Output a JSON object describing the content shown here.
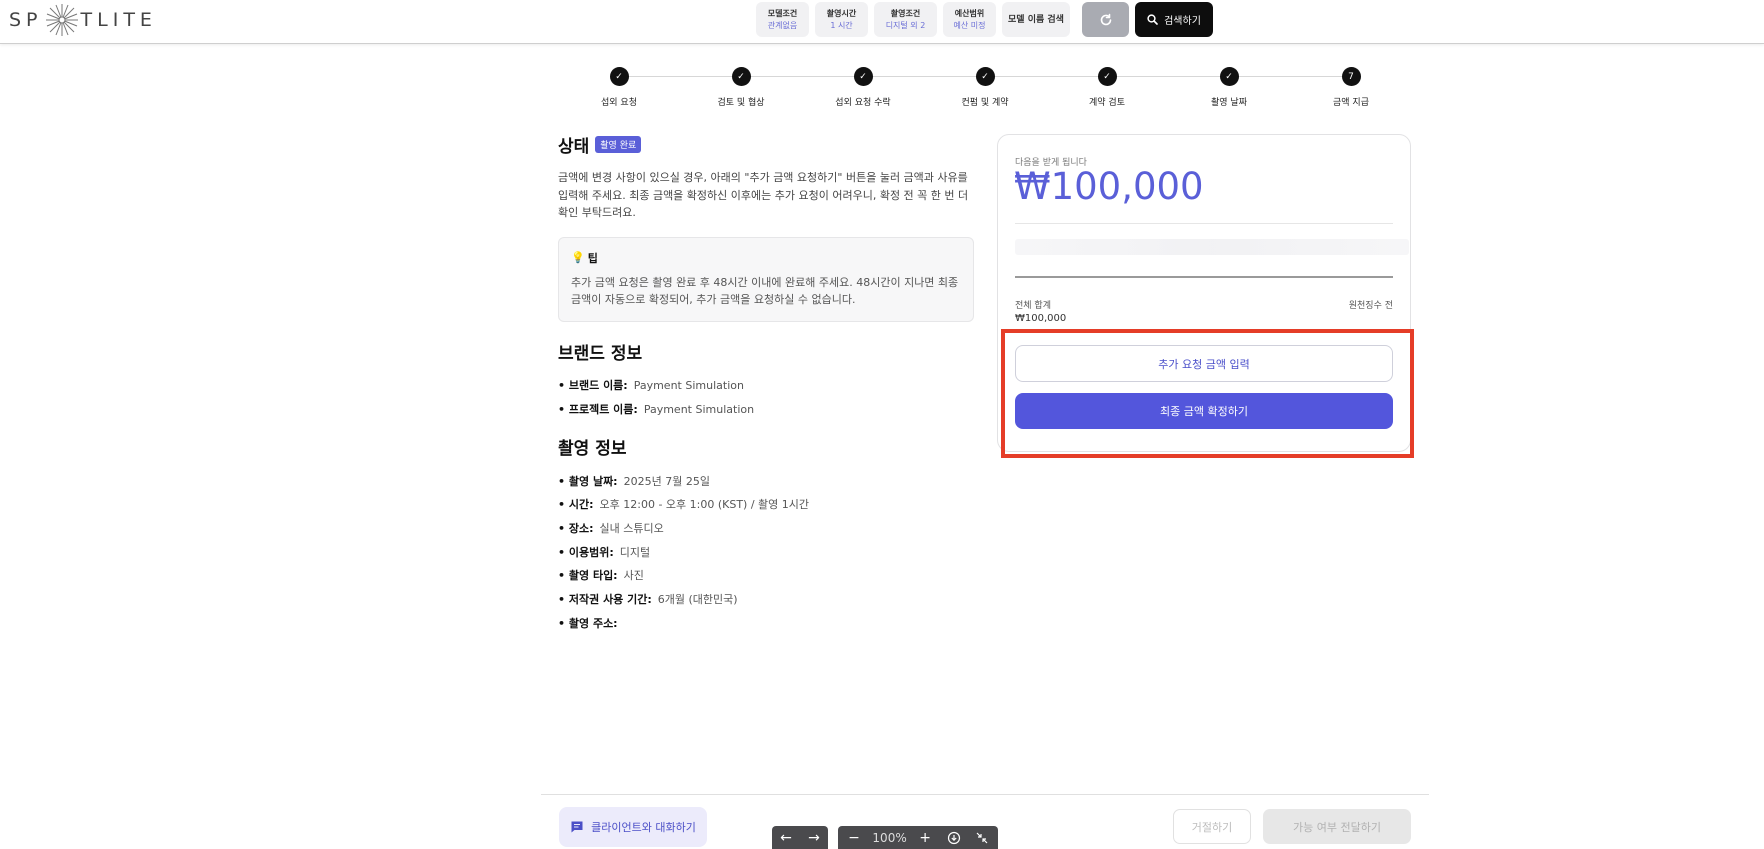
{
  "header": {
    "logo_left": "SP",
    "logo_right": "TLITE",
    "filters": [
      {
        "title": "모델조건",
        "value": "관계없음"
      },
      {
        "title": "촬영시간",
        "value": "1 시간"
      },
      {
        "title": "촬영조건",
        "value": "디지털 외 2"
      },
      {
        "title": "예산범위",
        "value": "예산 미정"
      }
    ],
    "model_name_search": "모델 이름 검색",
    "search_label": "검색하기"
  },
  "steps": [
    {
      "label": "섭외 요청",
      "mark": "✓"
    },
    {
      "label": "검토 및 협상",
      "mark": "✓"
    },
    {
      "label": "섭외 요청 수락",
      "mark": "✓"
    },
    {
      "label": "컨펌 및 계약",
      "mark": "✓"
    },
    {
      "label": "계약 검토",
      "mark": "✓"
    },
    {
      "label": "촬영 날짜",
      "mark": "✓"
    },
    {
      "label": "금액 지급",
      "mark": "7"
    }
  ],
  "status": {
    "title": "상태",
    "badge": "촬영 완료",
    "description": "금액에 변경 사항이 있으실 경우, 아래의 \"추가 금액 요청하기\" 버튼을 눌러 금액과 사유를 입력해 주세요. 최종 금액을 확정하신 이후에는 추가 요청이 어려우니, 확정 전 꼭 한 번 더 확인 부탁드려요.",
    "tip_title": "팁",
    "tip_text": "추가 금액 요청은 촬영 완료 후 48시간 이내에 완료해 주세요. 48시간이 지나면 최종 금액이 자동으로 확정되어, 추가 금액을 요청하실 수 없습니다."
  },
  "brand": {
    "title": "브랜드 정보",
    "items": [
      {
        "label": "브랜드 이름:",
        "value": "Payment Simulation"
      },
      {
        "label": "프로젝트 이름:",
        "value": "Payment Simulation"
      }
    ]
  },
  "shoot": {
    "title": "촬영 정보",
    "items": [
      {
        "label": "촬영 날짜:",
        "value": "2025년 7월 25일"
      },
      {
        "label": "시간:",
        "value": "오후 12:00 - 오후 1:00 (KST) / 촬영 1시간"
      },
      {
        "label": "장소:",
        "value": "실내 스튜디오"
      },
      {
        "label": "이용범위:",
        "value": "디지털"
      },
      {
        "label": "촬영 타입:",
        "value": "사진"
      },
      {
        "label": "저작권 사용 기간:",
        "value": "6개월 (대한민국)"
      },
      {
        "label": "촬영 주소:",
        "value": ""
      }
    ]
  },
  "payment": {
    "receive_label": "다음을 받게 됩니다",
    "amount": "₩100,000",
    "total_label": "전체 합계",
    "total_value": "₩100,000",
    "tax_note": "원천징수 전",
    "request_more_label": "추가 요청 금액 입력",
    "confirm_label": "최종 금액 확정하기"
  },
  "footer": {
    "chat_label": "클라이언트와 대화하기",
    "decline_label": "거절하기",
    "deliver_label": "가능 여부 전달하기"
  },
  "viewer": {
    "zoom": "100%"
  },
  "colors": {
    "accent": "#5356dc",
    "highlight": "#e53d28"
  }
}
